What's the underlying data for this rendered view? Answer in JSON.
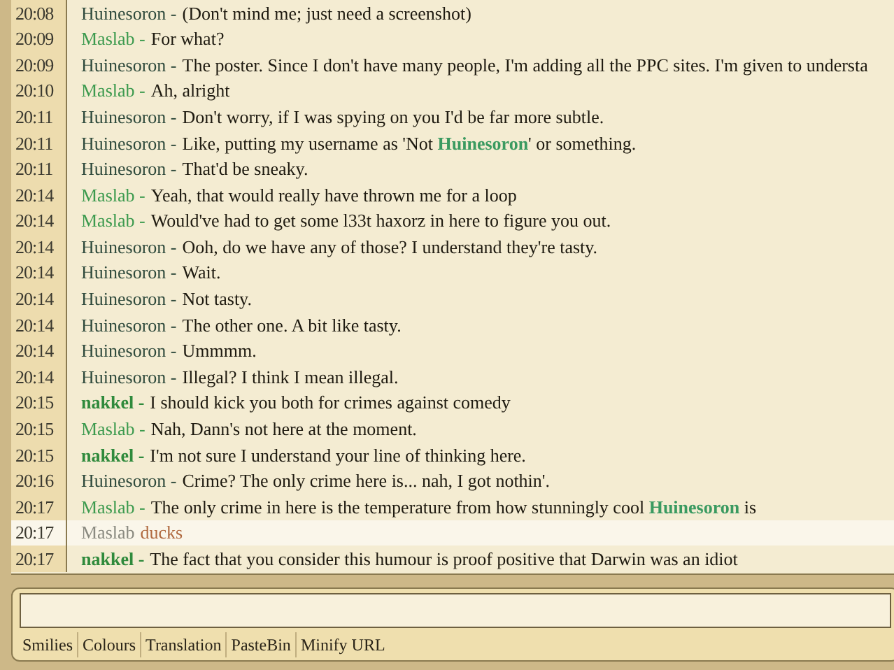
{
  "messages": [
    {
      "time": "20:08",
      "user": "Huinesoron -",
      "color": "#2f4a3c",
      "bold": false,
      "kind": "say",
      "text": "(Don't mind me; just need a screenshot)"
    },
    {
      "time": "20:09",
      "user": "Maslab -",
      "color": "#3c9a4e",
      "bold": false,
      "kind": "say",
      "text": "For what?"
    },
    {
      "time": "20:09",
      "user": "Huinesoron -",
      "color": "#2f4a3c",
      "bold": false,
      "kind": "say",
      "text": "The poster. Since I don't have many people, I'm adding all the PPC sites. I'm given to understa"
    },
    {
      "time": "20:10",
      "user": "Maslab -",
      "color": "#3c9a4e",
      "bold": false,
      "kind": "say",
      "text": "Ah, alright"
    },
    {
      "time": "20:11",
      "user": "Huinesoron -",
      "color": "#2f4a3c",
      "bold": false,
      "kind": "say",
      "text": "Don't worry, if I was spying on you I'd be far more subtle."
    },
    {
      "time": "20:11",
      "user": "Huinesoron -",
      "color": "#2f4a3c",
      "bold": false,
      "kind": "say",
      "text": "Like, putting my username as 'Not **Huinesoron**' or something."
    },
    {
      "time": "20:11",
      "user": "Huinesoron -",
      "color": "#2f4a3c",
      "bold": false,
      "kind": "say",
      "text": "That'd be sneaky."
    },
    {
      "time": "20:14",
      "user": "Maslab -",
      "color": "#3c9a4e",
      "bold": false,
      "kind": "say",
      "text": "Yeah, that would really have thrown me for a loop"
    },
    {
      "time": "20:14",
      "user": "Maslab -",
      "color": "#3c9a4e",
      "bold": false,
      "kind": "say",
      "text": "Would've had to get some l33t haxorz in here to figure you out."
    },
    {
      "time": "20:14",
      "user": "Huinesoron -",
      "color": "#2f4a3c",
      "bold": false,
      "kind": "say",
      "text": "Ooh, do we have any of those? I understand they're tasty."
    },
    {
      "time": "20:14",
      "user": "Huinesoron -",
      "color": "#2f4a3c",
      "bold": false,
      "kind": "say",
      "text": "Wait."
    },
    {
      "time": "20:14",
      "user": "Huinesoron -",
      "color": "#2f4a3c",
      "bold": false,
      "kind": "say",
      "text": "Not tasty."
    },
    {
      "time": "20:14",
      "user": "Huinesoron -",
      "color": "#2f4a3c",
      "bold": false,
      "kind": "say",
      "text": "The other one. A bit like tasty."
    },
    {
      "time": "20:14",
      "user": "Huinesoron -",
      "color": "#2f4a3c",
      "bold": false,
      "kind": "say",
      "text": "Ummmm."
    },
    {
      "time": "20:14",
      "user": "Huinesoron -",
      "color": "#2f4a3c",
      "bold": false,
      "kind": "say",
      "text": "Illegal? I think I mean illegal."
    },
    {
      "time": "20:15",
      "user": "nakkel -",
      "color": "#2f8a3c",
      "bold": true,
      "kind": "say",
      "text": "I should kick you both for crimes against comedy"
    },
    {
      "time": "20:15",
      "user": "Maslab -",
      "color": "#3c9a4e",
      "bold": false,
      "kind": "say",
      "text": "Nah, Dann's not here at the moment."
    },
    {
      "time": "20:15",
      "user": "nakkel -",
      "color": "#2f8a3c",
      "bold": true,
      "kind": "say",
      "text": "I'm not sure I understand your line of thinking here."
    },
    {
      "time": "20:16",
      "user": "Huinesoron -",
      "color": "#2f4a3c",
      "bold": false,
      "kind": "say",
      "text": "Crime? The only crime here is... nah, I got nothin'."
    },
    {
      "time": "20:17",
      "user": "Maslab -",
      "color": "#3c9a4e",
      "bold": false,
      "kind": "say",
      "text": "The only crime in here is the temperature from how stunningly cool **Huinesoron** is"
    },
    {
      "time": "20:17",
      "user": "Maslab",
      "color": "#8a8a80",
      "bold": false,
      "kind": "action",
      "text": "ducks"
    },
    {
      "time": "20:17",
      "user": "nakkel -",
      "color": "#2f8a3c",
      "bold": true,
      "kind": "say",
      "text": "The fact that you consider this humour is proof positive that Darwin was an idiot"
    }
  ],
  "toolbar_links": [
    "Smilies",
    "Colours",
    "Translation",
    "PasteBin",
    "Minify URL"
  ]
}
